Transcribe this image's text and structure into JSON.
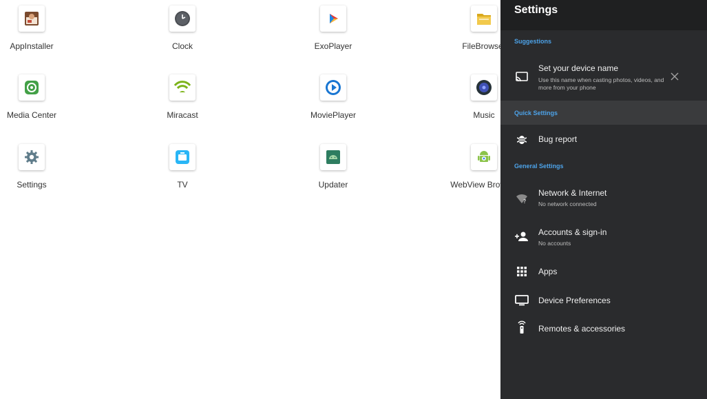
{
  "launcher": {
    "apps": [
      {
        "label": "AppInstaller",
        "icon": "app-installer-icon"
      },
      {
        "label": "Clock",
        "icon": "clock-icon"
      },
      {
        "label": "ExoPlayer",
        "icon": "exoplayer-icon"
      },
      {
        "label": "FileBrowser",
        "icon": "file-browser-icon"
      },
      {
        "label": "Media Center",
        "icon": "media-center-icon"
      },
      {
        "label": "Miracast",
        "icon": "miracast-icon"
      },
      {
        "label": "MoviePlayer",
        "icon": "movie-player-icon"
      },
      {
        "label": "Music",
        "icon": "music-icon"
      },
      {
        "label": "Settings",
        "icon": "settings-gear-icon"
      },
      {
        "label": "TV",
        "icon": "tv-icon"
      },
      {
        "label": "Updater",
        "icon": "updater-icon"
      },
      {
        "label": "WebView Browser",
        "icon": "webview-browser-icon"
      }
    ]
  },
  "panel": {
    "title": "Settings",
    "suggestions_header": "Suggestions",
    "suggestion": {
      "title": "Set your device name",
      "description": "Use this name when casting photos, videos, and more from your phone",
      "icon": "cast-icon",
      "dismiss_icon": "close-icon"
    },
    "quick_header": "Quick Settings",
    "quick_items": [
      {
        "title": "Bug report",
        "icon": "bug-icon"
      }
    ],
    "general_header": "General Settings",
    "general_items": [
      {
        "title": "Network & Internet",
        "subtitle": "No network connected",
        "icon": "wifi-unknown-icon"
      },
      {
        "title": "Accounts & sign-in",
        "subtitle": "No accounts",
        "icon": "add-person-icon"
      },
      {
        "title": "Apps",
        "subtitle": "",
        "icon": "apps-grid-icon"
      },
      {
        "title": "Device Preferences",
        "subtitle": "",
        "icon": "monitor-icon"
      },
      {
        "title": "Remotes & accessories",
        "subtitle": "",
        "icon": "remote-icon"
      }
    ]
  },
  "colors": {
    "panel_bg": "#2a2b2d",
    "panel_header_bg": "#1f2021",
    "section_header": "#4da3e9",
    "highlight_row": "#3a3b3d"
  }
}
